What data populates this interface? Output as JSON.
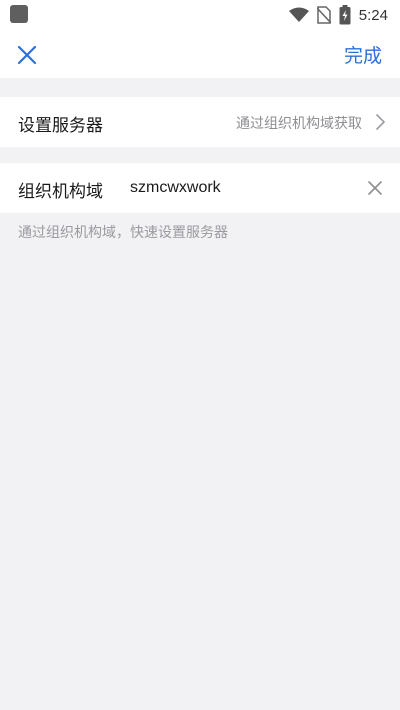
{
  "status_bar": {
    "time": "5:24",
    "icons": [
      "wifi-icon",
      "no-sim-icon",
      "battery-charging-icon"
    ]
  },
  "nav": {
    "close_icon": "close-icon",
    "done_label": "完成"
  },
  "server_row": {
    "label": "设置服务器",
    "value": "通过组织机构域获取",
    "icon": "chevron-right-icon"
  },
  "domain_row": {
    "label": "组织机构域",
    "value": "szmcwxwork",
    "icon": "clear-icon"
  },
  "hint": "通过组织机构域，快速设置服务器",
  "colors": {
    "accent": "#2d6fd9",
    "background": "#f2f2f4",
    "secondary_text": "#8e8e93"
  }
}
